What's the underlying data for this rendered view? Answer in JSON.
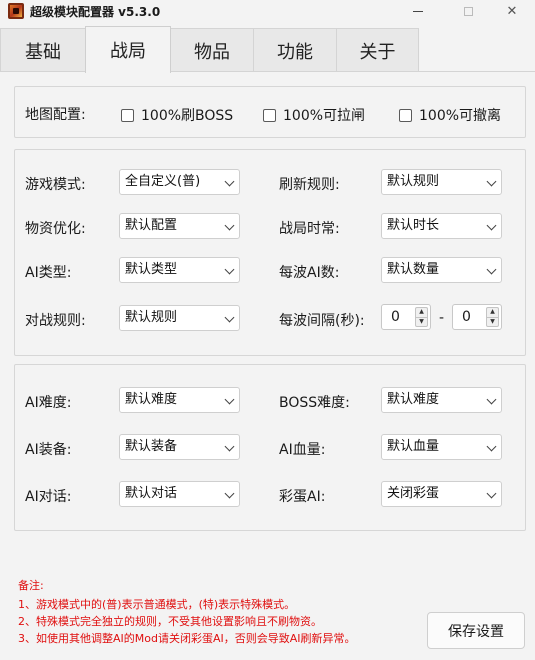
{
  "window": {
    "title": "超级模块配置器 v5.3.0",
    "controls": {
      "minimize": "—",
      "maximize": "☐",
      "close": "✕"
    }
  },
  "tabs": [
    {
      "label": "基础",
      "active": false
    },
    {
      "label": "战局",
      "active": true
    },
    {
      "label": "物品",
      "active": false
    },
    {
      "label": "功能",
      "active": false
    },
    {
      "label": "关于",
      "active": false
    }
  ],
  "map_config": {
    "label": "地图配置:",
    "options": [
      {
        "label": "100%刷BOSS",
        "checked": false
      },
      {
        "label": "100%可拉闸",
        "checked": false
      },
      {
        "label": "100%可撤离",
        "checked": false
      }
    ]
  },
  "battle_settings": {
    "game_mode": {
      "label": "游戏模式:",
      "value": "全自定义(普)"
    },
    "refresh_rule": {
      "label": "刷新规则:",
      "value": "默认规则"
    },
    "supply_opt": {
      "label": "物资优化:",
      "value": "默认配置"
    },
    "battle_duration": {
      "label": "战局时常:",
      "value": "默认时长"
    },
    "ai_type": {
      "label": "AI类型:",
      "value": "默认类型"
    },
    "wave_ai_count": {
      "label": "每波AI数:",
      "value": "默认数量"
    },
    "battle_rule": {
      "label": "对战规则:",
      "value": "默认规则"
    },
    "wave_interval": {
      "label": "每波间隔(秒):",
      "min": "0",
      "max": "0",
      "separator": "-"
    }
  },
  "ai_settings": {
    "ai_difficulty": {
      "label": "AI难度:",
      "value": "默认难度"
    },
    "boss_difficulty": {
      "label": "BOSS难度:",
      "value": "默认难度"
    },
    "ai_equipment": {
      "label": "AI装备:",
      "value": "默认装备"
    },
    "ai_health": {
      "label": "AI血量:",
      "value": "默认血量"
    },
    "ai_dialogue": {
      "label": "AI对话:",
      "value": "默认对话"
    },
    "easter_egg_ai": {
      "label": "彩蛋AI:",
      "value": "关闭彩蛋"
    }
  },
  "notes": {
    "title": "备注:",
    "lines": [
      "1、游戏模式中的(普)表示普通模式，(特)表示特殊模式。",
      "2、特殊模式完全独立的规则，不受其他设置影响且不刷物资。",
      "3、如使用其他调整AI的Mod请关闭彩蛋AI，否则会导致AI刷新异常。"
    ],
    "color": "#e01010"
  },
  "actions": {
    "save_label": "保存设置"
  }
}
